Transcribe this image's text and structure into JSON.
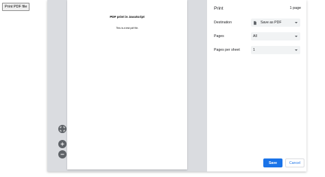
{
  "page": {
    "trigger_button": "Print PDF file"
  },
  "preview": {
    "document_heading": "PDF print in JavaScript",
    "document_body": "This is a test pdf file.",
    "controls": {
      "fit_icon": "fit-to-page-icon",
      "zoom_in_icon": "plus-icon",
      "zoom_out_icon": "minus-icon"
    }
  },
  "settings": {
    "title": "Print",
    "page_count": "1 page",
    "destination": {
      "label": "Destination",
      "value": "Save as PDF",
      "icon": "document-icon"
    },
    "pages": {
      "label": "Pages",
      "value": "All"
    },
    "pages_per_sheet": {
      "label": "Pages per sheet",
      "value": "1"
    },
    "save_label": "Save",
    "cancel_label": "Cancel"
  },
  "colors": {
    "accent": "#1a73e8",
    "preview_background": "#dadce0",
    "select_background": "#f1f3f4",
    "zoom_button": "#5f6368"
  }
}
